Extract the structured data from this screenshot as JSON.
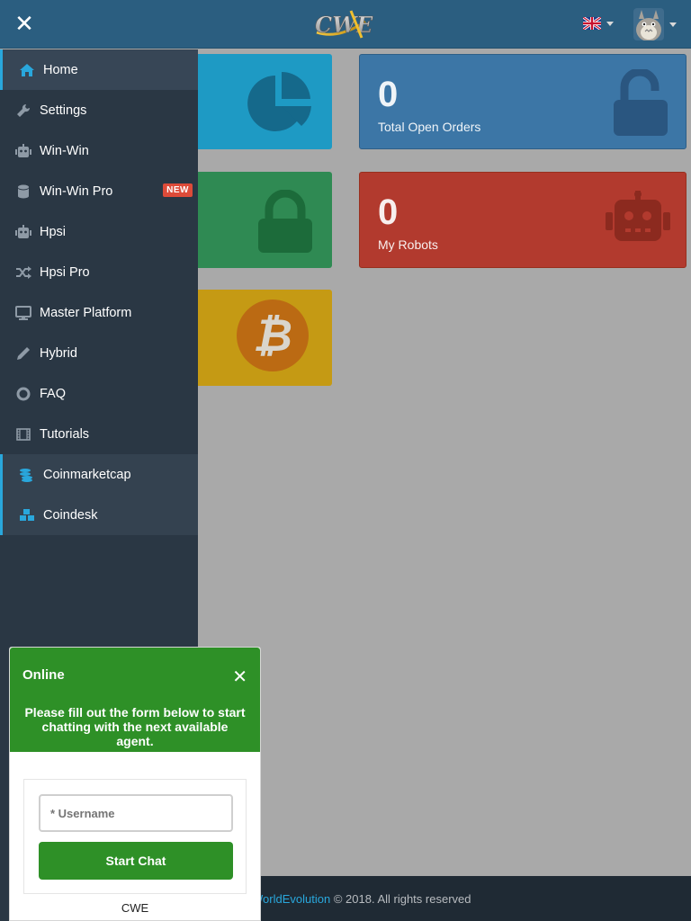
{
  "header": {
    "logo_text": "CWE",
    "close_icon": "close-icon",
    "language_flag": "uk-flag-icon",
    "avatar": "user-avatar"
  },
  "cards": {
    "total_open_orders": {
      "value": "0",
      "label": "Total Open Orders",
      "color": "#3c76a6",
      "icon": "unlock-icon"
    },
    "my_robots": {
      "value": "0",
      "label": "My Robots",
      "color": "#b23a2e",
      "icon": "robot-icon"
    },
    "blue_card": {
      "color": "#1e9ac4",
      "icon": "pie-chart-icon"
    },
    "green_card": {
      "color": "#2f8a53",
      "icon": "lock-icon"
    },
    "yellow_card": {
      "color": "#c59a14",
      "icon": "bitcoin-icon"
    }
  },
  "sidebar": {
    "items": [
      {
        "label": "Home",
        "icon": "home-icon",
        "active": true
      },
      {
        "label": "Settings",
        "icon": "wrench-icon"
      },
      {
        "label": "Win-Win",
        "icon": "robot-icon"
      },
      {
        "label": "Win-Win Pro",
        "icon": "database-icon",
        "badge": "NEW"
      },
      {
        "label": "Hpsi",
        "icon": "robot-icon"
      },
      {
        "label": "Hpsi Pro",
        "icon": "shuffle-icon"
      },
      {
        "label": "Master Platform",
        "icon": "desktop-icon"
      },
      {
        "label": "Hybrid",
        "icon": "pencil-icon"
      },
      {
        "label": "FAQ",
        "icon": "life-ring-icon"
      },
      {
        "label": "Tutorials",
        "icon": "film-icon"
      },
      {
        "label": "Coinmarketcap",
        "icon": "coins-icon"
      },
      {
        "label": "Coindesk",
        "icon": "cubes-icon"
      }
    ]
  },
  "footer": {
    "link_text": "WorldEvolution",
    "copyright": "© 2018. All rights reserved"
  },
  "chat": {
    "status": "Online",
    "message": "Please fill out the form below to start chatting with the next available agent.",
    "username_placeholder": "* Username",
    "start_button": "Start Chat",
    "brand": "CWE",
    "header_color": "#2e9027"
  }
}
